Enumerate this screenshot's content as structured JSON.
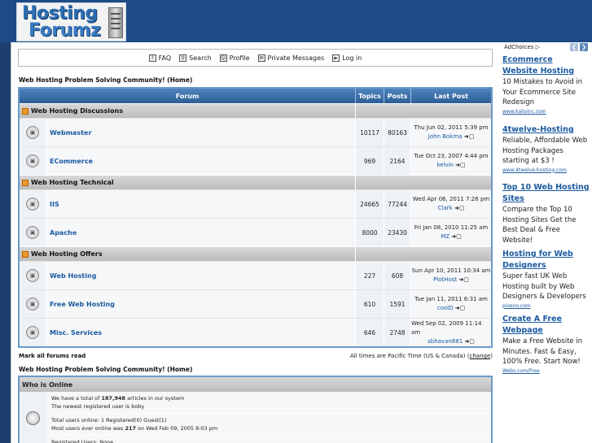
{
  "logo": {
    "line1": "Hosting",
    "line2": "Forumz"
  },
  "nav": [
    {
      "label": "FAQ",
      "icon": "faq-icon"
    },
    {
      "label": "Search",
      "icon": "search-icon"
    },
    {
      "label": "Profile",
      "icon": "profile-icon"
    },
    {
      "label": "Private Messages",
      "icon": "messages-icon"
    },
    {
      "label": "Log in",
      "icon": "login-icon"
    }
  ],
  "site_link_top": "Web Hosting Problem Solving Community! (Home)",
  "site_link_bottom": "Web Hosting Problem Solving Community! (Home)",
  "table": {
    "headers": {
      "forum": "Forum",
      "topics": "Topics",
      "posts": "Posts",
      "last_post": "Last Post"
    },
    "categories": [
      {
        "name": "Web Hosting Discussions",
        "forums": [
          {
            "name": "Webmaster",
            "topics": "10117",
            "posts": "80163",
            "last_date": "Thu Jun 02, 2011 5:39 pm",
            "last_user": "John Bokma"
          },
          {
            "name": "ECommerce",
            "topics": "969",
            "posts": "2164",
            "last_date": "Tue Oct 23, 2007 4:44 pm",
            "last_user": "kelvin"
          }
        ]
      },
      {
        "name": "Web Hosting Technical",
        "forums": [
          {
            "name": "IIS",
            "topics": "24665",
            "posts": "77244",
            "last_date": "Wed Apr 06, 2011 7:26 pm",
            "last_user": "Clark"
          },
          {
            "name": "Apache",
            "topics": "8000",
            "posts": "23430",
            "last_date": "Fri Jan 08, 2010 11:25 am",
            "last_user": "MZ"
          }
        ]
      },
      {
        "name": "Web Hosting Offers",
        "forums": [
          {
            "name": "Web Hosting",
            "topics": "227",
            "posts": "608",
            "last_date": "Sun Apr 10, 2011 10:34 am",
            "last_user": "PlotHost"
          },
          {
            "name": "Free Web Hosting",
            "topics": "610",
            "posts": "1591",
            "last_date": "Tue Jan 11, 2011 6:31 am",
            "last_user": "coolD"
          },
          {
            "name": "Misc. Services",
            "topics": "646",
            "posts": "2748",
            "last_date": "Wed Sep 02, 2009 11:14 am",
            "last_user": "sbhavan881"
          }
        ]
      }
    ]
  },
  "mark_read": "Mark all forums read",
  "timezone_prefix": "All times are Pacific Time (US & Canada) (",
  "timezone_link": "change",
  "timezone_suffix": ")",
  "who": {
    "title": "Who is Online",
    "articles_prefix": "We have a total of ",
    "articles_count": "187,948",
    "articles_suffix": " articles in our system",
    "newest": "The newest registered user is boby",
    "online": "Total users online: 1 Registered(0) Guest(1)",
    "most_prefix": "Most users ever online was ",
    "most_count": "217",
    "most_suffix": " on Wed Feb 09, 2005 8:03 pm",
    "registered": "Registered Users: None"
  },
  "ads": {
    "adchoices": "AdChoices",
    "items": [
      {
        "title": "Ecommerce Website Hosting",
        "body": "10 Mistakes to Avoid in Your Ecommerce Site Redesign",
        "url": "www.kalioinc.com"
      },
      {
        "title": "4twelve-Hosting",
        "body": "Reliable, Affordable Web Hosting Packages starting at $3 !",
        "url": "www.4twelve-hosting.com"
      },
      {
        "title": "Top 10 Web Hosting Sites",
        "body": "Compare the Top 10 Hosting Sites Get the Best Deal & Free Website!",
        "url": ""
      },
      {
        "title": "Hosting for Web Designers",
        "body": "Super fast UK Web Hosting built by Web Designers & Developers",
        "url": "pixeno.com"
      },
      {
        "title": "Create A Free Webpage",
        "body": "Make a Free Website in Minutes. Fast & Easy, 100% Free. Start Now!",
        "url": "Webs.com/Free"
      }
    ]
  },
  "colors": {
    "header_blue": "#1d4b86",
    "link_blue": "#1b5aa0",
    "table_border": "#6b9ac9"
  }
}
